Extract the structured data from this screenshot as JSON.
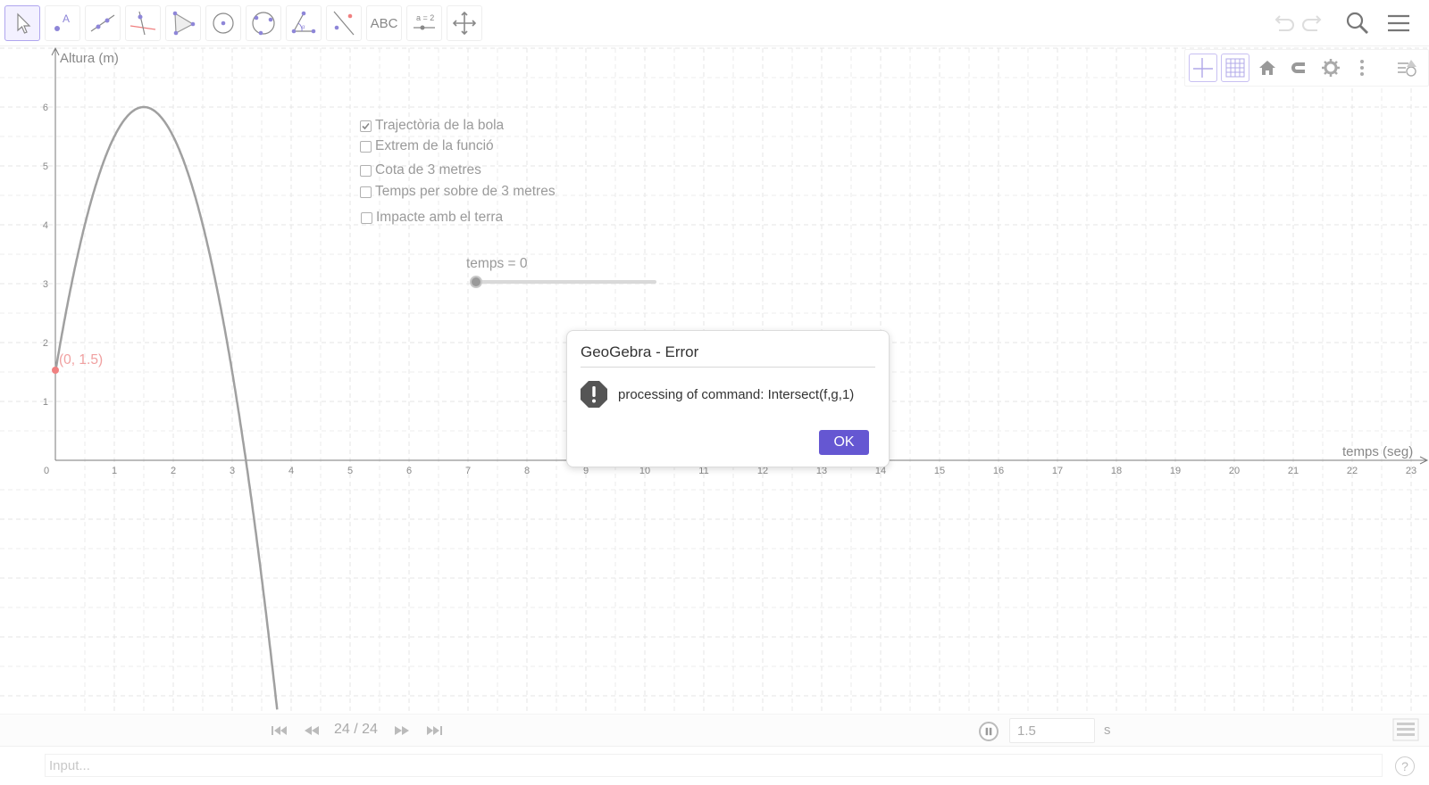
{
  "toolbar": {
    "tools": [
      {
        "name": "move-tool",
        "selected": true
      },
      {
        "name": "point-tool"
      },
      {
        "name": "line-tool"
      },
      {
        "name": "perpendicular-line-tool"
      },
      {
        "name": "polygon-tool"
      },
      {
        "name": "circle-tool"
      },
      {
        "name": "conic-tool"
      },
      {
        "name": "angle-tool"
      },
      {
        "name": "reflect-tool"
      },
      {
        "name": "text-tool",
        "label": "ABC"
      },
      {
        "name": "slider-tool",
        "label": "a = 2"
      },
      {
        "name": "move-graphics-view-tool"
      }
    ]
  },
  "graph": {
    "y_axis_label": "Altura (m)",
    "x_axis_label": "temps (seg)",
    "point_label": "(0, 1.5)",
    "x_ticks": [
      "0",
      "1",
      "2",
      "3",
      "4",
      "5",
      "6",
      "7",
      "8",
      "9",
      "10",
      "11",
      "12",
      "13",
      "14",
      "15",
      "16",
      "17",
      "18",
      "19",
      "20",
      "21",
      "22",
      "23"
    ],
    "y_ticks": [
      "1",
      "2",
      "3",
      "4",
      "5",
      "6"
    ]
  },
  "checkboxes": [
    {
      "label": "Trajectòria de la bola",
      "checked": true
    },
    {
      "label": "Extrem de la funció",
      "checked": false
    },
    {
      "label": "Cota de 3 metres",
      "checked": false
    },
    {
      "label": "Temps per sobre de 3 metres",
      "checked": false
    },
    {
      "label": "Impacte amb el terra",
      "checked": false
    }
  ],
  "slider": {
    "label": "temps = 0",
    "value": 0
  },
  "dialog": {
    "title": "GeoGebra - Error",
    "message": "processing of command: Intersect(f,g,1)",
    "ok_label": "OK"
  },
  "navbar": {
    "step_count": "24 / 24",
    "speed_value": "1.5",
    "speed_unit": "s"
  },
  "inputbar": {
    "placeholder": "Input...",
    "help_label": "?"
  },
  "colors": {
    "accent": "#6557d2",
    "curve": "#a0a0a0",
    "point": "#f0a0a0",
    "grid": "#e6e6e6"
  }
}
